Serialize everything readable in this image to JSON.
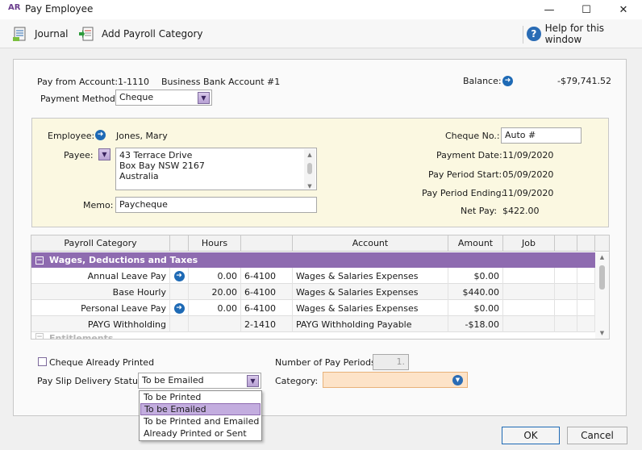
{
  "window": {
    "logo": "AR",
    "title": "Pay Employee",
    "minimize": "—",
    "maximize": "☐",
    "close": "✕"
  },
  "toolbar": {
    "journal_label": "Journal",
    "add_category_label": "Add Payroll Category",
    "help_label": "Help for this window"
  },
  "header": {
    "pay_from_label": "Pay from Account:",
    "account_number": "1-1110",
    "account_name": "Business Bank Account #1",
    "balance_label": "Balance:",
    "balance_value": "-$79,741.52",
    "payment_method_label": "Payment Method:",
    "payment_method_value": "Cheque"
  },
  "employee": {
    "employee_label": "Employee:",
    "employee_name": "Jones, Mary",
    "payee_label": "Payee:",
    "address_lines": [
      "43 Terrace Drive",
      "Box Bay  NSW  2167",
      "Australia"
    ],
    "memo_label": "Memo:",
    "memo_value": "Paycheque",
    "cheque_no_label": "Cheque No.:",
    "cheque_no_value": "Auto #",
    "payment_date_label": "Payment Date:",
    "payment_date_value": "11/09/2020",
    "period_start_label": "Pay Period Start:",
    "period_start_value": "05/09/2020",
    "period_end_label": "Pay Period Ending:",
    "period_end_value": "11/09/2020",
    "net_pay_label": "Net Pay:",
    "net_pay_value": "$422.00"
  },
  "grid": {
    "columns": [
      "Payroll Category",
      "Hours",
      "Account",
      "Amount",
      "Job"
    ],
    "group_label": "Wages, Deductions and Taxes",
    "rows": [
      {
        "category": "Annual Leave Pay",
        "hours": "0.00",
        "acct_no": "6-4100",
        "account": "Wages & Salaries Expenses",
        "amount": "$0.00"
      },
      {
        "category": "Base Hourly",
        "hours": "20.00",
        "acct_no": "6-4100",
        "account": "Wages & Salaries Expenses",
        "amount": "$440.00"
      },
      {
        "category": "Personal Leave Pay",
        "hours": "0.00",
        "acct_no": "6-4100",
        "account": "Wages & Salaries Expenses",
        "amount": "$0.00"
      },
      {
        "category": "PAYG Withholding",
        "hours": "",
        "acct_no": "2-1410",
        "account": "PAYG Withholding Payable",
        "amount": "-$18.00"
      }
    ],
    "partial_group_label": "Entitlements"
  },
  "footer": {
    "cheque_printed_label": "Cheque Already Printed",
    "num_periods_label": "Number of Pay Periods:",
    "num_periods_value": "1.",
    "delivery_label": "Pay Slip Delivery Status:",
    "delivery_value": "To be Emailed",
    "category_label": "Category:",
    "delivery_options": [
      "To be Printed",
      "To be Emailed",
      "To be Printed and Emailed",
      "Already Printed or Sent"
    ],
    "ok_label": "OK",
    "cancel_label": "Cancel"
  },
  "colors": {
    "accent": "#8e6bb0",
    "selection": "#c3addf",
    "info_panel": "#fbf8e1",
    "link_blue": "#1e6ab5",
    "category_field": "#fde3c8"
  }
}
